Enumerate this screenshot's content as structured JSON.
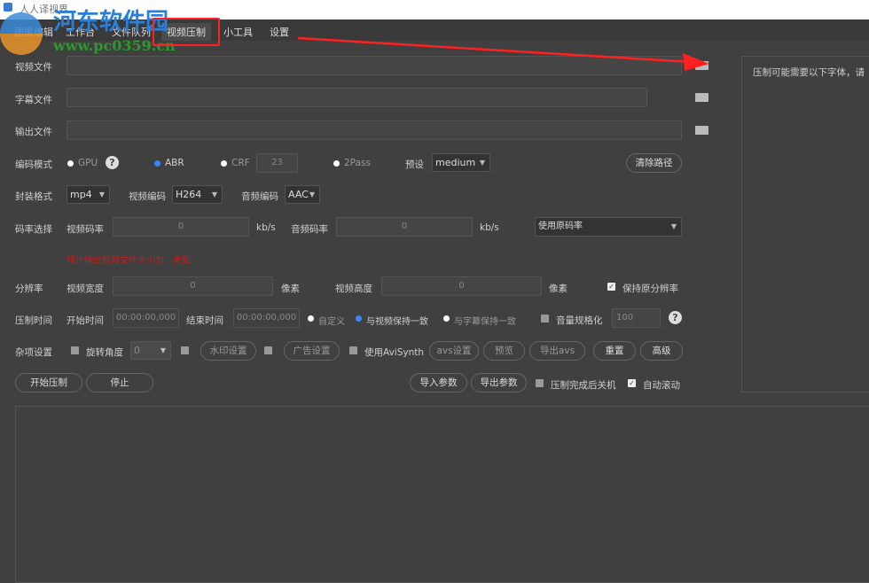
{
  "app": {
    "title": "人人译视界"
  },
  "tabs": [
    "图像编辑",
    "工作台",
    "文件队列",
    "视频压制",
    "小工具",
    "设置"
  ],
  "files": {
    "video_label": "视频文件",
    "subtitle_label": "字幕文件",
    "output_label": "输出文件"
  },
  "encode": {
    "label": "编码模式",
    "gpu": "GPU",
    "abr": "ABR",
    "crf": "CRF",
    "crf_value": "23",
    "twopass": "2Pass",
    "preset_label": "预设",
    "preset_value": "medium",
    "clear_paths": "清除路径"
  },
  "format": {
    "label": "封装格式",
    "container": "mp4",
    "video_codec_label": "视频编码",
    "video_codec": "H264",
    "audio_codec_label": "音频编码",
    "audio_codec": "AAC"
  },
  "bitrate": {
    "label": "码率选择",
    "video_label": "视频码率",
    "video_value": "0",
    "unit1": "kb/s",
    "audio_label": "音频码率",
    "audio_value": "0",
    "unit2": "kb/s",
    "mode": "使用原码率"
  },
  "estimate": "预计输出视频文件大小为：未知",
  "resolution": {
    "label": "分辨率",
    "width_label": "视频宽度",
    "width_value": "0",
    "unit1": "像素",
    "height_label": "视频高度",
    "height_value": "0",
    "unit2": "像素",
    "keep": "保持原分辨率"
  },
  "time": {
    "label": "压制时间",
    "start_label": "开始时间",
    "start_value": "00:00:00,000",
    "end_label": "结束时间",
    "end_value": "00:00:00,000",
    "custom": "自定义",
    "match_video": "与视频保持一致",
    "match_subtitle": "与字幕保持一致",
    "normalize": "音量规格化",
    "normalize_value": "100"
  },
  "misc": {
    "label": "杂项设置",
    "rotate": "旋转角度",
    "rotate_value": "0",
    "watermark": "水印设置",
    "ad": "广告设置",
    "avisynth": "使用AviSynth",
    "avs_settings": "avs设置",
    "preview": "预览",
    "export_avs": "导出avs",
    "reset": "重置",
    "advanced": "高级"
  },
  "actions": {
    "start": "开始压制",
    "stop": "停止",
    "import": "导入参数",
    "export": "导出参数",
    "shutdown": "压制完成后关机",
    "autoscroll": "自动滚动"
  },
  "right_panel": {
    "text": "压制可能需要以下字体，请"
  },
  "watermark": {
    "name": "河东软件园",
    "url": "www.pc0359.cn"
  },
  "colors": {
    "accent": "#3a86ff",
    "warning": "#e02020",
    "annotation": "#ff2020"
  }
}
